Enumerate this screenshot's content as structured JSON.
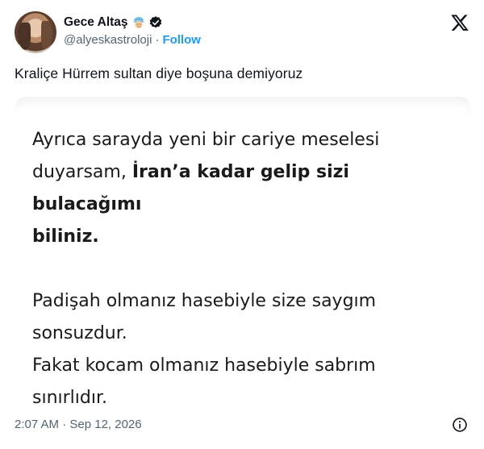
{
  "author": {
    "display_name": "Gece Altaş",
    "handle": "@alyeskastroloji",
    "separator": "·",
    "follow_label": "Follow"
  },
  "tweet": {
    "text": "Kraliçe Hürrem sultan diye boşuna demiyoruz",
    "timestamp": "2:07 AM · Sep 12, 2026"
  },
  "media": {
    "line1": "Ayrıca sarayda yeni bir cariye meselesi",
    "line2_plain": "duyarsam, ",
    "line2_bold": "İran’a kadar gelip sizi bulacağımı",
    "line3_bold": "biliniz.",
    "line4": "Padişah olmanız hasebiyle size saygım",
    "line5": "sonsuzdur.",
    "line6": "Fakat kocam olmanız hasebiyle sabrım",
    "line7": "sınırlıdır."
  },
  "icons": {
    "emoji": "man-with-turban-emoji-icon",
    "verified": "verified-badge-icon",
    "platform": "x-logo-icon",
    "info": "info-icon"
  },
  "colors": {
    "link": "#1d9bf0",
    "secondary_text": "#536471",
    "primary_text": "#0f1419"
  }
}
